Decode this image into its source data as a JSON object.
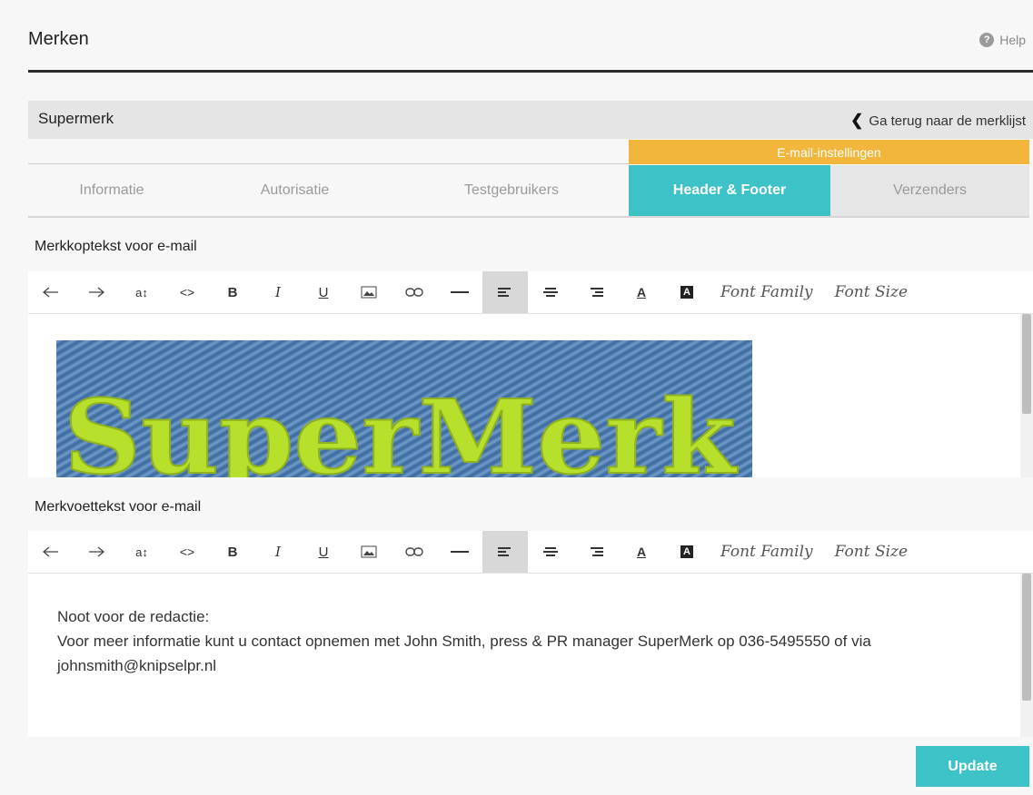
{
  "header": {
    "title": "Merken",
    "help_label": "Help"
  },
  "brand": {
    "name": "Supermerk",
    "back_label": "Ga terug naar de merklijst"
  },
  "tabs": {
    "group_label": "E-mail-instellingen",
    "items": [
      {
        "label": "Informatie"
      },
      {
        "label": "Autorisatie"
      },
      {
        "label": "Testgebruikers"
      },
      {
        "label": "Header & Footer"
      },
      {
        "label": "Verzenders"
      }
    ],
    "active": "Header & Footer"
  },
  "header_section": {
    "label": "Merkkoptekst voor e-mail",
    "banner_text": "SuperMerk"
  },
  "footer_section": {
    "label": "Merkvoettekst voor e-mail",
    "line1": "Noot voor de redactie:",
    "line2": "Voor meer informatie kunt u contact opnemen met John Smith, press & PR manager SuperMerk op 036-5495550 of via johnsmith@knipselpr.nl"
  },
  "toolbar": {
    "buttons": [
      "undo-icon",
      "redo-icon",
      "text-size-icon",
      "code-icon",
      "bold-icon",
      "italic-icon",
      "underline-icon",
      "image-icon",
      "link-icon",
      "horizontal-rule-icon",
      "align-left-icon",
      "align-center-icon",
      "align-right-icon",
      "font-color-icon",
      "background-color-icon"
    ],
    "bold": "B",
    "italic": "I",
    "underline": "U",
    "font_family": "Font Family",
    "font_size": "Font Size"
  },
  "actions": {
    "update_label": "Update"
  },
  "colors": {
    "accent_teal": "#3dc2c8",
    "accent_orange": "#f2b63d",
    "banner_text": "#b6e02b",
    "denim": "#4a79ad"
  }
}
